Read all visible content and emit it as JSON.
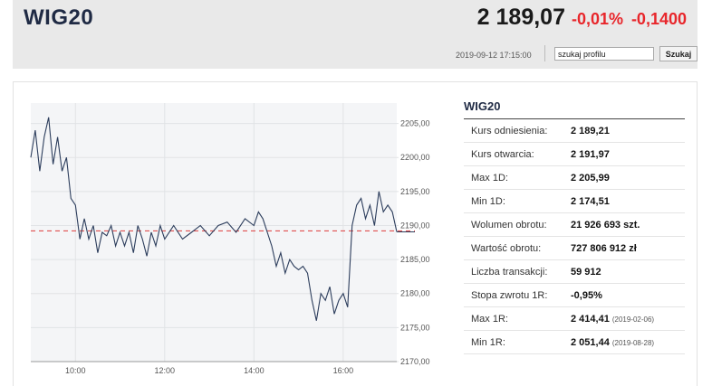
{
  "header": {
    "title": "WIG20",
    "price": "2 189,07",
    "change_pct": "-0,01%",
    "change_abs": "-0,1400",
    "datetime": "2019-09-12 17:15:00",
    "search_value": "szukaj profilu",
    "search_button": "Szukaj"
  },
  "colors": {
    "negative": "#e8262b",
    "line": "#2c3d5c",
    "reference": "#e05050",
    "header_bg": "#e9e9e9"
  },
  "table": {
    "title": "WIG20",
    "rows": [
      {
        "label": "Kurs odniesienia:",
        "value": "2 189,21",
        "date": ""
      },
      {
        "label": "Kurs otwarcia:",
        "value": "2 191,97",
        "date": ""
      },
      {
        "label": "Max 1D:",
        "value": "2 205,99",
        "date": ""
      },
      {
        "label": "Min 1D:",
        "value": "2 174,51",
        "date": ""
      },
      {
        "label": "Wolumen obrotu:",
        "value": "21 926 693 szt.",
        "date": ""
      },
      {
        "label": "Wartość obrotu:",
        "value": "727 806 912 zł",
        "date": ""
      },
      {
        "label": "Liczba transakcji:",
        "value": "59 912",
        "date": ""
      },
      {
        "label": "Stopa zwrotu 1R:",
        "value": "-0,95%",
        "date": ""
      },
      {
        "label": "Max 1R:",
        "value": "2 414,41",
        "date": "(2019-02-06)"
      },
      {
        "label": "Min 1R:",
        "value": "2 051,44",
        "date": "(2019-08-28)"
      }
    ]
  },
  "chart_data": {
    "type": "line",
    "ylim": [
      2170,
      2208
    ],
    "xlim": [
      9.0,
      17.2
    ],
    "y_ticks": [
      2170,
      2175,
      2180,
      2185,
      2190,
      2195,
      2200,
      2205
    ],
    "y_tick_labels": [
      "2170,00",
      "2175,00",
      "2180,00",
      "2185,00",
      "2190,00",
      "2195,00",
      "2200,00",
      "2205,00"
    ],
    "x_ticks": [
      10,
      12,
      14,
      16
    ],
    "x_tick_labels": [
      "10:00",
      "12:00",
      "14:00",
      "16:00"
    ],
    "reference_value": 2189.21,
    "grid": true,
    "series": [
      {
        "x": [
          9.0,
          9.1,
          9.2,
          9.3,
          9.4,
          9.5,
          9.6,
          9.7,
          9.8,
          9.9,
          10.0,
          10.1,
          10.2,
          10.3,
          10.4,
          10.5,
          10.6,
          10.7,
          10.8,
          10.9,
          11.0,
          11.1,
          11.2,
          11.3,
          11.4,
          11.5,
          11.6,
          11.7,
          11.8,
          11.9,
          12.0,
          12.2,
          12.4,
          12.6,
          12.8,
          13.0,
          13.2,
          13.4,
          13.6,
          13.8,
          14.0,
          14.1,
          14.2,
          14.3,
          14.4,
          14.5,
          14.6,
          14.7,
          14.8,
          14.9,
          15.0,
          15.1,
          15.2,
          15.3,
          15.4,
          15.5,
          15.6,
          15.7,
          15.8,
          15.9,
          16.0,
          16.1,
          16.2,
          16.3,
          16.4,
          16.5,
          16.6,
          16.7,
          16.8,
          16.9,
          17.0,
          17.1,
          17.2
        ],
        "y": [
          2200,
          2204,
          2198,
          2203,
          2205.9,
          2199,
          2203,
          2198,
          2200,
          2194,
          2193,
          2188,
          2191,
          2188,
          2190,
          2186,
          2189,
          2188.5,
          2190,
          2187,
          2189,
          2187,
          2189,
          2186,
          2190,
          2188,
          2185.5,
          2189,
          2187,
          2190,
          2188,
          2190,
          2188,
          2189,
          2190,
          2188.5,
          2190,
          2190.5,
          2189,
          2191,
          2190,
          2192,
          2191,
          2189,
          2187,
          2184,
          2186,
          2183,
          2185,
          2184,
          2183.5,
          2184,
          2183,
          2179,
          2176,
          2180,
          2179,
          2181,
          2177,
          2179,
          2180,
          2178,
          2190,
          2193,
          2194,
          2191,
          2193,
          2190,
          2195,
          2192,
          2193,
          2192,
          2189.07
        ]
      }
    ]
  }
}
